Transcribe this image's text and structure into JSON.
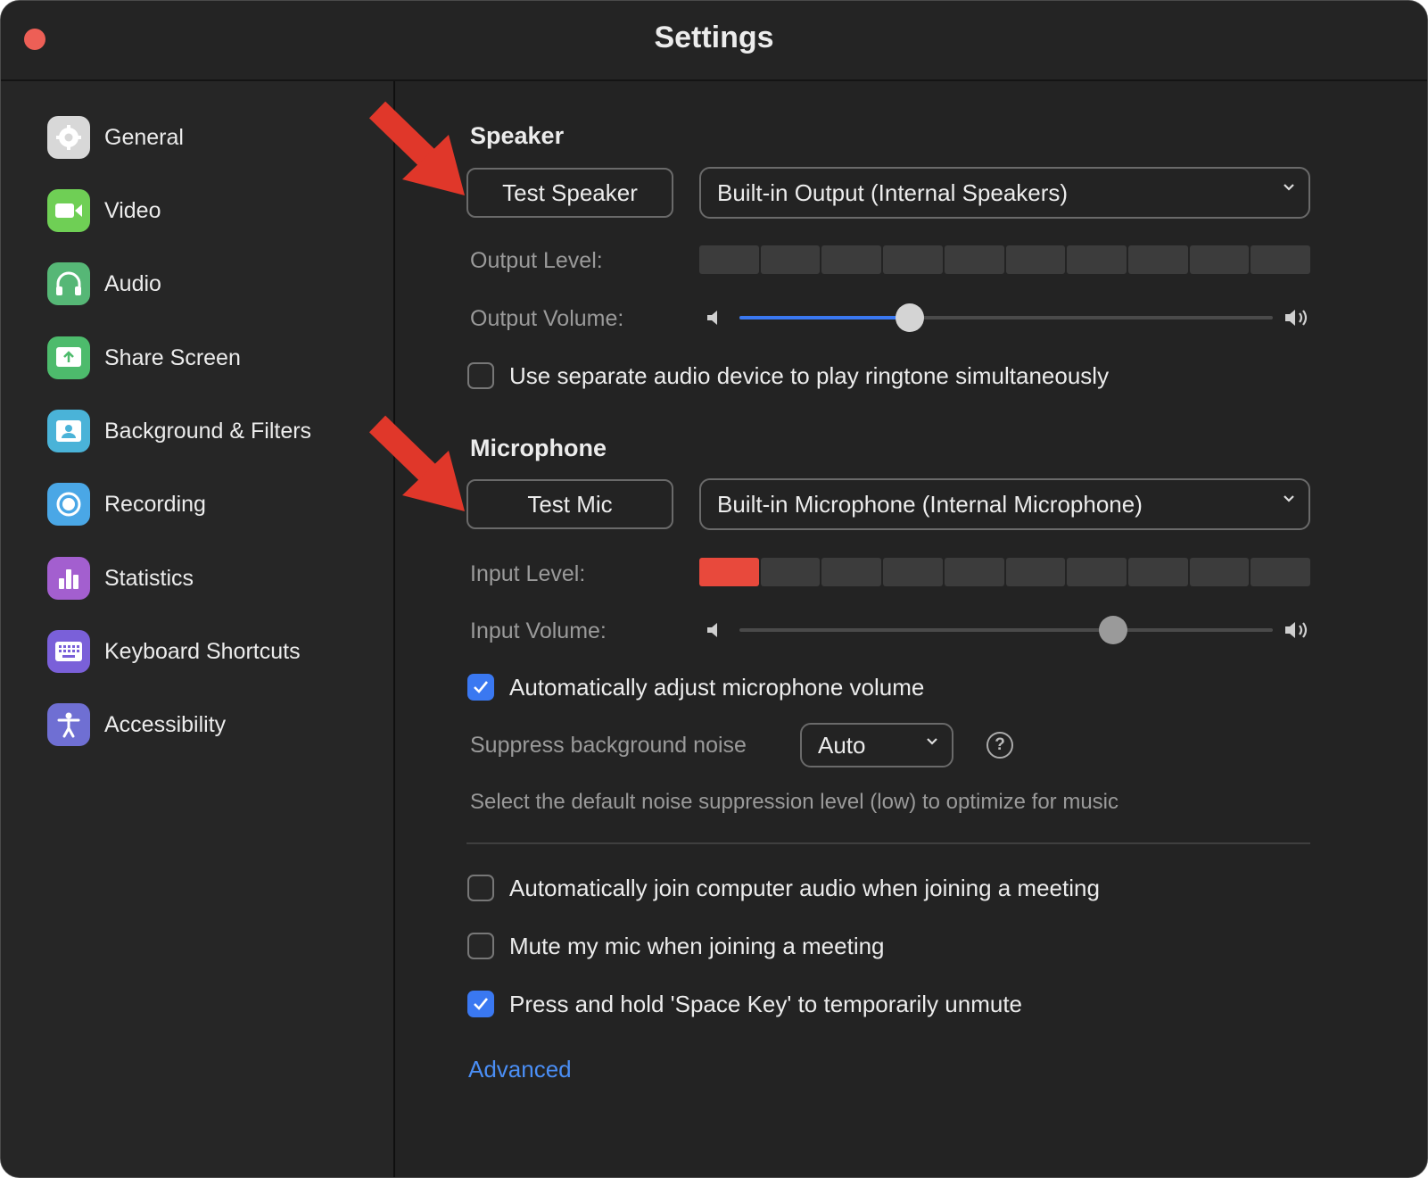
{
  "window": {
    "title": "Settings"
  },
  "sidebar": {
    "items": [
      {
        "label": "General",
        "icon": "gear-icon",
        "color": "#d8d8d8"
      },
      {
        "label": "Video",
        "icon": "camera-icon",
        "color": "#6fcf55"
      },
      {
        "label": "Audio",
        "icon": "headphones-icon",
        "color": "#56b776"
      },
      {
        "label": "Share Screen",
        "icon": "share-screen-icon",
        "color": "#4dbb6c"
      },
      {
        "label": "Background & Filters",
        "icon": "person-portrait-icon",
        "color": "#4ab3d8"
      },
      {
        "label": "Recording",
        "icon": "record-icon",
        "color": "#4aa7e6"
      },
      {
        "label": "Statistics",
        "icon": "bar-chart-icon",
        "color": "#a35fcf"
      },
      {
        "label": "Keyboard Shortcuts",
        "icon": "keyboard-icon",
        "color": "#7a60d9"
      },
      {
        "label": "Accessibility",
        "icon": "accessibility-icon",
        "color": "#6f6fd3"
      }
    ]
  },
  "speaker": {
    "title": "Speaker",
    "test_label": "Test Speaker",
    "device": "Built-in Output (Internal Speakers)",
    "output_level_label": "Output Level:",
    "output_level_active_segments": 0,
    "output_level_total_segments": 10,
    "output_volume_label": "Output Volume:",
    "output_volume_value": 0.32,
    "ringtone_label": "Use separate audio device to play ringtone simultaneously",
    "ringtone_checked": false
  },
  "microphone": {
    "title": "Microphone",
    "test_label": "Test Mic",
    "device": "Built-in Microphone (Internal Microphone)",
    "input_level_label": "Input Level:",
    "input_level_active_segments": 1,
    "input_level_total_segments": 10,
    "input_volume_label": "Input Volume:",
    "input_volume_value": 0.7,
    "auto_adjust_label": "Automatically adjust microphone volume",
    "auto_adjust_checked": true,
    "suppress_label": "Suppress background noise",
    "suppress_value": "Auto",
    "suppress_hint": "Select the default noise suppression level (low) to optimize for music",
    "help_symbol": "?"
  },
  "options": [
    {
      "label": "Automatically join computer audio when joining a meeting",
      "checked": false
    },
    {
      "label": "Mute my mic when joining a meeting",
      "checked": false
    },
    {
      "label": "Press and hold 'Space Key' to temporarily unmute",
      "checked": true
    }
  ],
  "advanced_label": "Advanced",
  "colors": {
    "accent": "#3a78f1",
    "level_active": "#e8493c",
    "annotation_arrow": "#e0372a",
    "close": "#ed5f56"
  }
}
